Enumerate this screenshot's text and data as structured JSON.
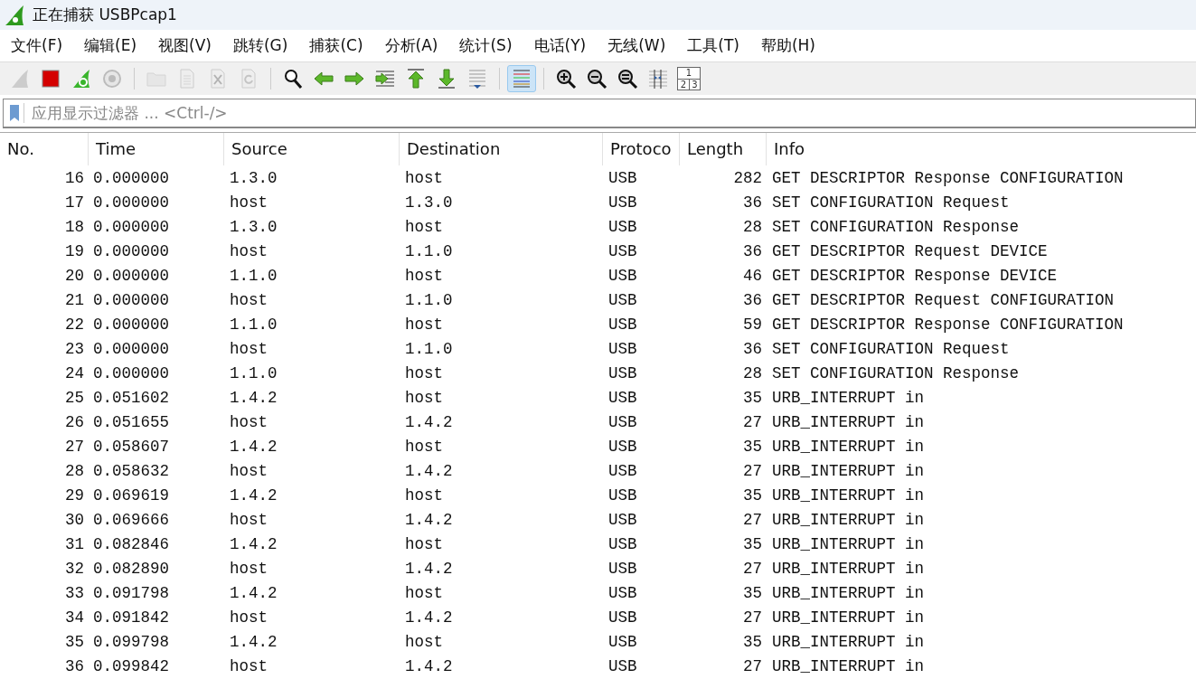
{
  "window": {
    "title": "正在捕获 USBPcap1"
  },
  "menu": [
    "文件(F)",
    "编辑(E)",
    "视图(V)",
    "跳转(G)",
    "捕获(C)",
    "分析(A)",
    "统计(S)",
    "电话(Y)",
    "无线(W)",
    "工具(T)",
    "帮助(H)"
  ],
  "toolbar": [
    {
      "kind": "fin",
      "disabled": true
    },
    {
      "kind": "stop",
      "disabled": false
    },
    {
      "kind": "restart",
      "disabled": false
    },
    {
      "kind": "gear",
      "disabled": true
    },
    {
      "kind": "sep"
    },
    {
      "kind": "folder",
      "disabled": true
    },
    {
      "kind": "file",
      "disabled": true
    },
    {
      "kind": "close-file",
      "disabled": true
    },
    {
      "kind": "reload",
      "disabled": true
    },
    {
      "kind": "sep"
    },
    {
      "kind": "search",
      "disabled": false
    },
    {
      "kind": "back",
      "disabled": false
    },
    {
      "kind": "forward",
      "disabled": false
    },
    {
      "kind": "goto",
      "disabled": false
    },
    {
      "kind": "first",
      "disabled": false
    },
    {
      "kind": "last",
      "disabled": false
    },
    {
      "kind": "autoscroll",
      "disabled": false,
      "selected": false
    },
    {
      "kind": "sep"
    },
    {
      "kind": "colorize",
      "disabled": false,
      "selected": true
    },
    {
      "kind": "sep"
    },
    {
      "kind": "zoom-in",
      "disabled": false
    },
    {
      "kind": "zoom-out",
      "disabled": false
    },
    {
      "kind": "zoom-reset",
      "disabled": false
    },
    {
      "kind": "resize",
      "disabled": false
    },
    {
      "kind": "layout",
      "disabled": false,
      "labels": [
        "1",
        "2",
        "3"
      ]
    }
  ],
  "filter": {
    "placeholder": "应用显示过滤器 ... <Ctrl-/>"
  },
  "table": {
    "columns": [
      "No.",
      "Time",
      "Source",
      "Destination",
      "Protoco",
      "Length",
      "Info"
    ],
    "rows": [
      [
        "16",
        "0.000000",
        "1.3.0",
        "host",
        "USB",
        "282",
        "GET DESCRIPTOR Response CONFIGURATION"
      ],
      [
        "17",
        "0.000000",
        "host",
        "1.3.0",
        "USB",
        "36",
        "SET CONFIGURATION Request"
      ],
      [
        "18",
        "0.000000",
        "1.3.0",
        "host",
        "USB",
        "28",
        "SET CONFIGURATION Response"
      ],
      [
        "19",
        "0.000000",
        "host",
        "1.1.0",
        "USB",
        "36",
        "GET DESCRIPTOR Request DEVICE"
      ],
      [
        "20",
        "0.000000",
        "1.1.0",
        "host",
        "USB",
        "46",
        "GET DESCRIPTOR Response DEVICE"
      ],
      [
        "21",
        "0.000000",
        "host",
        "1.1.0",
        "USB",
        "36",
        "GET DESCRIPTOR Request CONFIGURATION"
      ],
      [
        "22",
        "0.000000",
        "1.1.0",
        "host",
        "USB",
        "59",
        "GET DESCRIPTOR Response CONFIGURATION"
      ],
      [
        "23",
        "0.000000",
        "host",
        "1.1.0",
        "USB",
        "36",
        "SET CONFIGURATION Request"
      ],
      [
        "24",
        "0.000000",
        "1.1.0",
        "host",
        "USB",
        "28",
        "SET CONFIGURATION Response"
      ],
      [
        "25",
        "0.051602",
        "1.4.2",
        "host",
        "USB",
        "35",
        "URB_INTERRUPT in"
      ],
      [
        "26",
        "0.051655",
        "host",
        "1.4.2",
        "USB",
        "27",
        "URB_INTERRUPT in"
      ],
      [
        "27",
        "0.058607",
        "1.4.2",
        "host",
        "USB",
        "35",
        "URB_INTERRUPT in"
      ],
      [
        "28",
        "0.058632",
        "host",
        "1.4.2",
        "USB",
        "27",
        "URB_INTERRUPT in"
      ],
      [
        "29",
        "0.069619",
        "1.4.2",
        "host",
        "USB",
        "35",
        "URB_INTERRUPT in"
      ],
      [
        "30",
        "0.069666",
        "host",
        "1.4.2",
        "USB",
        "27",
        "URB_INTERRUPT in"
      ],
      [
        "31",
        "0.082846",
        "1.4.2",
        "host",
        "USB",
        "35",
        "URB_INTERRUPT in"
      ],
      [
        "32",
        "0.082890",
        "host",
        "1.4.2",
        "USB",
        "27",
        "URB_INTERRUPT in"
      ],
      [
        "33",
        "0.091798",
        "1.4.2",
        "host",
        "USB",
        "35",
        "URB_INTERRUPT in"
      ],
      [
        "34",
        "0.091842",
        "host",
        "1.4.2",
        "USB",
        "27",
        "URB_INTERRUPT in"
      ],
      [
        "35",
        "0.099798",
        "1.4.2",
        "host",
        "USB",
        "35",
        "URB_INTERRUPT in"
      ],
      [
        "36",
        "0.099842",
        "host",
        "1.4.2",
        "USB",
        "27",
        "URB_INTERRUPT in"
      ]
    ]
  }
}
